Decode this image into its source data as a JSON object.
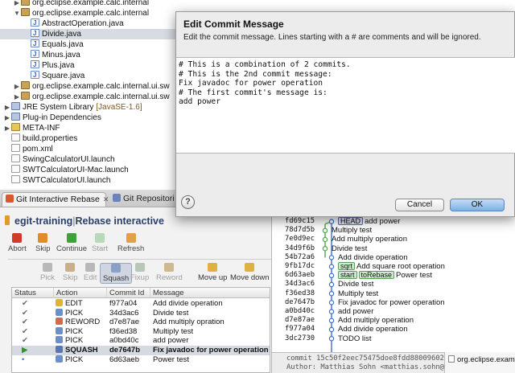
{
  "tree": {
    "rows": [
      {
        "label": "org.eclipse.example.calc.internal",
        "level": 1,
        "icon": "package-icon",
        "expanded": false
      },
      {
        "label": "org.eclipse.example.calc.internal",
        "level": 1,
        "icon": "package-icon",
        "expanded": true
      },
      {
        "label": "AbstractOperation.java",
        "level": 2,
        "icon": "java-file-icon"
      },
      {
        "label": "Divide.java",
        "level": 2,
        "icon": "java-file-icon",
        "selected": true
      },
      {
        "label": "Equals.java",
        "level": 2,
        "icon": "java-file-icon"
      },
      {
        "label": "Minus.java",
        "level": 2,
        "icon": "java-file-icon"
      },
      {
        "label": "Plus.java",
        "level": 2,
        "icon": "java-file-icon"
      },
      {
        "label": "Square.java",
        "level": 2,
        "icon": "java-file-icon"
      },
      {
        "label": "org.eclipse.example.calc.internal.ui.sw",
        "level": 1,
        "icon": "package-icon",
        "expanded": false
      },
      {
        "label": "org.eclipse.example.calc.internal.ui.sw",
        "level": 1,
        "icon": "package-icon",
        "expanded": false
      },
      {
        "label": "JRE System Library",
        "tag": "[JavaSE-1.6]",
        "level": 0,
        "icon": "library-icon",
        "expanded": false
      },
      {
        "label": "Plug-in Dependencies",
        "level": 0,
        "icon": "library-icon",
        "expanded": false
      },
      {
        "label": "META-INF",
        "level": 0,
        "icon": "folder-icon",
        "expanded": false
      },
      {
        "label": "build.properties",
        "level": 0,
        "icon": "file-icon"
      },
      {
        "label": "pom.xml",
        "level": 0,
        "icon": "file-icon"
      },
      {
        "label": "SwingCalculatorUI.launch",
        "level": 0,
        "icon": "file-icon"
      },
      {
        "label": "SWTCalculatorUI-Mac.launch",
        "level": 0,
        "icon": "file-icon"
      },
      {
        "label": "SWTCalculatorUI.launch",
        "level": 0,
        "icon": "file-icon"
      }
    ]
  },
  "dialog": {
    "title": "Edit Commit Message",
    "description": "Edit the commit message. Lines starting with a # are comments and will be ignored.",
    "message": "# This is a combination of 2 commits.\n# This is the 2nd commit message:\nFix javadoc for power operation\n# The first commit's message is:\nadd power",
    "help_label": "?",
    "cancel_label": "Cancel",
    "ok_label": "OK"
  },
  "rebase_view": {
    "tabs": [
      {
        "label": "Git Interactive Rebase",
        "active": true,
        "close": "✕"
      },
      {
        "label": "Git Repositori",
        "active": false
      }
    ],
    "repo": "egit-training",
    "separator": "|",
    "mode": "Rebase interactive",
    "toolbar": [
      {
        "label": "Abort",
        "enabled": true,
        "color": "#d23a2a"
      },
      {
        "label": "Skip",
        "enabled": true,
        "color": "#e08a2a"
      },
      {
        "label": "Continue",
        "enabled": true,
        "color": "#3aa33a"
      },
      {
        "label": "Start",
        "enabled": false,
        "color": "#b8d8b8"
      },
      {
        "label": "Refresh",
        "enabled": true,
        "color": "#e0a048"
      }
    ],
    "actions": [
      {
        "label": "Pick",
        "enabled": false
      },
      {
        "label": "Skip",
        "enabled": false
      },
      {
        "label": "Edit",
        "enabled": false
      },
      {
        "label": "Squash",
        "enabled": true,
        "pressed": true
      },
      {
        "label": "Fixup",
        "enabled": false
      },
      {
        "label": "Reword",
        "enabled": false
      },
      {
        "label": "Move up",
        "enabled": true
      },
      {
        "label": "Move down",
        "enabled": true
      }
    ],
    "columns": [
      "Status",
      "Action",
      "Commit Id",
      "Message"
    ],
    "steps": [
      {
        "status": "done",
        "action": "EDIT",
        "commit": "f977a04",
        "message": "Add divide operation"
      },
      {
        "status": "done",
        "action": "PICK",
        "commit": "34d3ac6",
        "message": "Divide test"
      },
      {
        "status": "done",
        "action": "REWORD",
        "commit": "d7e87ae",
        "message": "Add multiply opration"
      },
      {
        "status": "done",
        "action": "PICK",
        "commit": "f36ed38",
        "message": "Multiply test"
      },
      {
        "status": "done",
        "action": "PICK",
        "commit": "a0bd40c",
        "message": "add power"
      },
      {
        "status": "current",
        "action": "SQUASH",
        "commit": "de7647b",
        "message": "Fix javadoc for power operation"
      },
      {
        "status": "todo",
        "action": "PICK",
        "commit": "6d63aeb",
        "message": "Power test"
      }
    ]
  },
  "history": {
    "rows": [
      {
        "id": "fd69c15",
        "refs": [
          {
            "name": "HEAD",
            "kind": "head"
          }
        ],
        "message": "add power",
        "lane": 2
      },
      {
        "id": "78d7d5b",
        "refs": [],
        "message": "Multiply test",
        "lane": 1
      },
      {
        "id": "7e0d9ec",
        "refs": [],
        "message": "Add multiply operation",
        "lane": 1
      },
      {
        "id": "34d9f6b",
        "refs": [],
        "message": "Divide test",
        "lane": 1
      },
      {
        "id": "54b72a6",
        "refs": [],
        "message": "Add divide operation",
        "lane": 2
      },
      {
        "id": "9fb17dc",
        "refs": [
          {
            "name": "sqrt",
            "kind": "branch"
          }
        ],
        "message": "Add square root operation",
        "lane": 2
      },
      {
        "id": "6d63aeb",
        "refs": [
          {
            "name": "start",
            "kind": "branch"
          },
          {
            "name": "toRebase",
            "kind": "branch"
          }
        ],
        "message": "Power test",
        "lane": 2
      },
      {
        "id": "34d3ac6",
        "refs": [],
        "message": "Divide test",
        "lane": 2
      },
      {
        "id": "f36ed38",
        "refs": [],
        "message": "Multiply test",
        "lane": 2
      },
      {
        "id": "de7647b",
        "refs": [],
        "message": "Fix javadoc for power operation",
        "lane": 2
      },
      {
        "id": "a0bd40c",
        "refs": [],
        "message": "add power",
        "lane": 2
      },
      {
        "id": "d7e87ae",
        "refs": [],
        "message": "Add multiply operation",
        "lane": 2
      },
      {
        "id": "f977a04",
        "refs": [],
        "message": "Add divide operation",
        "lane": 2
      },
      {
        "id": "3dc2730",
        "refs": [],
        "message": "TODO list",
        "lane": 2
      }
    ],
    "footer_line1": "commit 15c50f2eec75475doe8fdd88009602f",
    "footer_line2": "Author: Matthias Sohn <matthias.sohn@s",
    "side_tab": "org.eclipse.exam"
  },
  "colors": {
    "selection": "#d7dbe2",
    "dialog_bg": "#ececec",
    "ok_button": "#7cb0e8",
    "graph_line_main": "#3a6fd0",
    "graph_line_branch": "#4aa84a",
    "current_step": "#d5d9e0"
  }
}
